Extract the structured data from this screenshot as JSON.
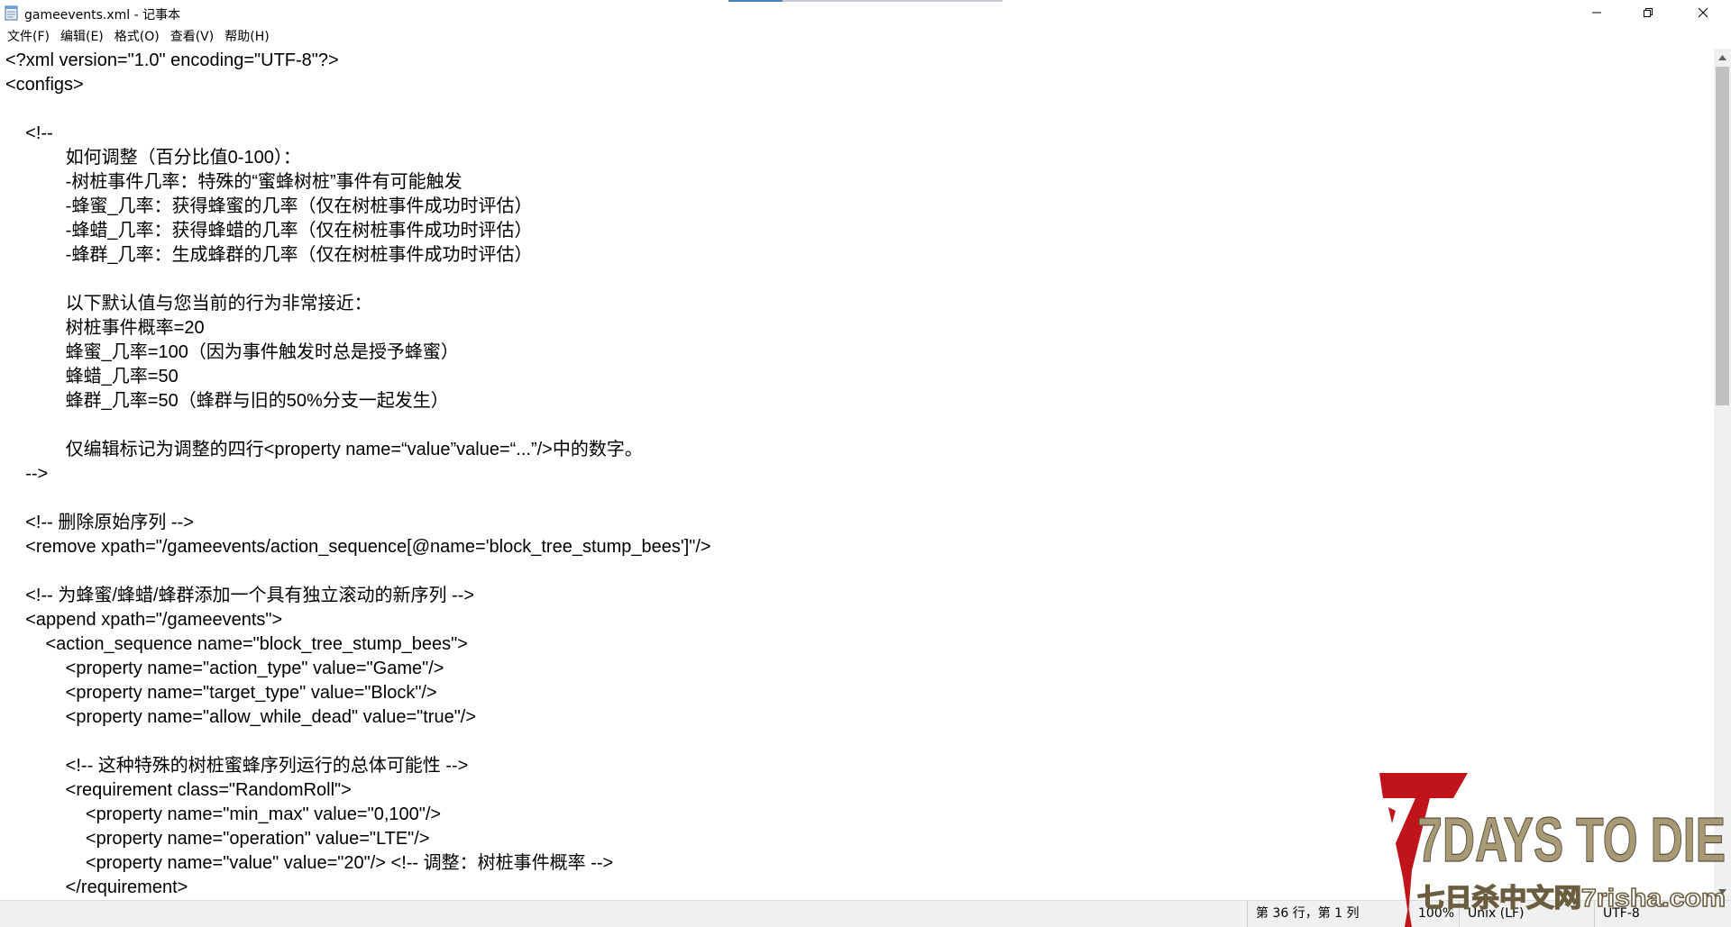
{
  "window": {
    "title": "gameevents.xml - 记事本"
  },
  "icons": {
    "app": "notepad-icon",
    "minimize": "minimize-icon",
    "maximize": "restore-icon",
    "close": "close-icon"
  },
  "menu": {
    "items": [
      "文件(F)",
      "编辑(E)",
      "格式(O)",
      "查看(V)",
      "帮助(H)"
    ]
  },
  "editor": {
    "lines": [
      "<?xml version=\"1.0\" encoding=\"UTF-8\"?>",
      "<configs>",
      "",
      "    <!--",
      "            如何调整（百分比值0-100）：",
      "            -树桩事件几率：特殊的“蜜蜂树桩”事件有可能触发",
      "            -蜂蜜_几率：获得蜂蜜的几率（仅在树桩事件成功时评估）",
      "            -蜂蜡_几率：获得蜂蜡的几率（仅在树桩事件成功时评估）",
      "            -蜂群_几率：生成蜂群的几率（仅在树桩事件成功时评估）",
      "",
      "            以下默认值与您当前的行为非常接近：",
      "            树桩事件概率=20",
      "            蜂蜜_几率=100（因为事件触发时总是授予蜂蜜）",
      "            蜂蜡_几率=50",
      "            蜂群_几率=50（蜂群与旧的50%分支一起发生）",
      "",
      "            仅编辑标记为调整的四行<property name=“value”value=“...”/>中的数字。",
      "    -->",
      "",
      "    <!-- 删除原始序列 -->",
      "    <remove xpath=\"/gameevents/action_sequence[@name='block_tree_stump_bees']\"/>",
      "",
      "    <!-- 为蜂蜜/蜂蜡/蜂群添加一个具有独立滚动的新序列 -->",
      "    <append xpath=\"/gameevents\">",
      "        <action_sequence name=\"block_tree_stump_bees\">",
      "            <property name=\"action_type\" value=\"Game\"/>",
      "            <property name=\"target_type\" value=\"Block\"/>",
      "            <property name=\"allow_while_dead\" value=\"true\"/>",
      "",
      "            <!-- 这种特殊的树桩蜜蜂序列运行的总体可能性 -->",
      "            <requirement class=\"RandomRoll\">",
      "                <property name=\"min_max\" value=\"0,100\"/>",
      "                <property name=\"operation\" value=\"LTE\"/>",
      "                <property name=\"value\" value=\"20\"/> <!-- 调整：树桩事件概率 -->",
      "            </requirement>"
    ]
  },
  "status": {
    "position": "第 36 行，第 1 列",
    "zoom": "100%",
    "line_ending": "Unix (LF)",
    "encoding": "UTF-8"
  },
  "watermark": {
    "title": "7DAYS TO DIE",
    "subtitle": "七日杀中文网7risha.com"
  },
  "colors": {
    "status_bg": "#f0f0f0",
    "scroll_thumb": "#c1c1c1",
    "logo_red": "#c0141a",
    "logo_khaki": "#a89a74"
  }
}
